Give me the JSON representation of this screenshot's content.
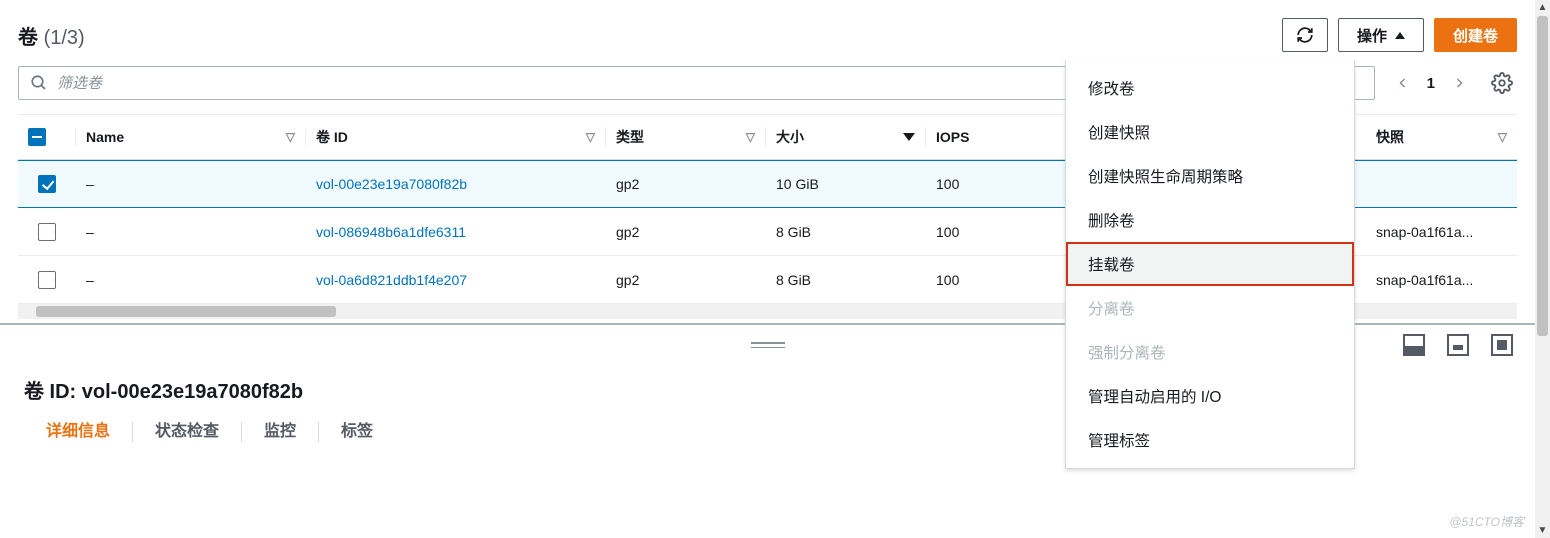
{
  "header": {
    "title_label": "卷",
    "count_text": "(1/3)",
    "actions_label": "操作",
    "create_label": "创建卷"
  },
  "search": {
    "placeholder": "筛选卷"
  },
  "pager": {
    "current": "1"
  },
  "columns": {
    "name": "Name",
    "id": "卷 ID",
    "type": "类型",
    "size": "大小",
    "iops": "IOPS",
    "snapshot": "快照"
  },
  "rows": [
    {
      "selected": true,
      "name": "–",
      "id": "vol-00e23e19a7080f82b",
      "type": "gp2",
      "size": "10 GiB",
      "iops": "100",
      "snapshot": ""
    },
    {
      "selected": false,
      "name": "–",
      "id": "vol-086948b6a1dfe6311",
      "type": "gp2",
      "size": "8 GiB",
      "iops": "100",
      "snapshot": "snap-0a1f61a..."
    },
    {
      "selected": false,
      "name": "–",
      "id": "vol-0a6d821ddb1f4e207",
      "type": "gp2",
      "size": "8 GiB",
      "iops": "100",
      "snapshot": "snap-0a1f61a..."
    }
  ],
  "actions_menu": {
    "modify": "修改卷",
    "snapshot": "创建快照",
    "lifecycle": "创建快照生命周期策略",
    "delete": "删除卷",
    "attach": "挂载卷",
    "detach": "分离卷",
    "force": "强制分离卷",
    "autoio": "管理自动启用的 I/O",
    "tags": "管理标签"
  },
  "detail": {
    "prefix": "卷 ID: ",
    "id": "vol-00e23e19a7080f82b",
    "tabs": {
      "info": "详细信息",
      "status": "状态检查",
      "monitor": "监控",
      "tags": "标签"
    }
  },
  "watermark": "@51CTO博客"
}
